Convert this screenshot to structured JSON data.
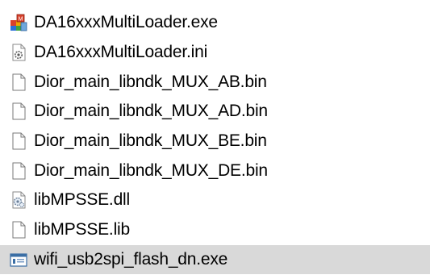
{
  "files": [
    {
      "name": "DA16xxxMultiLoader.exe",
      "icon": "application-exe-icon"
    },
    {
      "name": "DA16xxxMultiLoader.ini",
      "icon": "config-settings-file-icon"
    },
    {
      "name": "Dior_main_libndk_MUX_AB.bin",
      "icon": "blank-file-icon"
    },
    {
      "name": "Dior_main_libndk_MUX_AD.bin",
      "icon": "blank-file-icon"
    },
    {
      "name": "Dior_main_libndk_MUX_BE.bin",
      "icon": "blank-file-icon"
    },
    {
      "name": "Dior_main_libndk_MUX_DE.bin",
      "icon": "blank-file-icon"
    },
    {
      "name": "libMPSSE.dll",
      "icon": "dll-file-icon"
    },
    {
      "name": "libMPSSE.lib",
      "icon": "blank-file-icon"
    },
    {
      "name": "wifi_usb2spi_flash_dn.exe",
      "icon": "window-app-icon",
      "selected": true
    }
  ],
  "colors": {
    "selected_row": "#d9d9d9",
    "text": "#000000"
  }
}
